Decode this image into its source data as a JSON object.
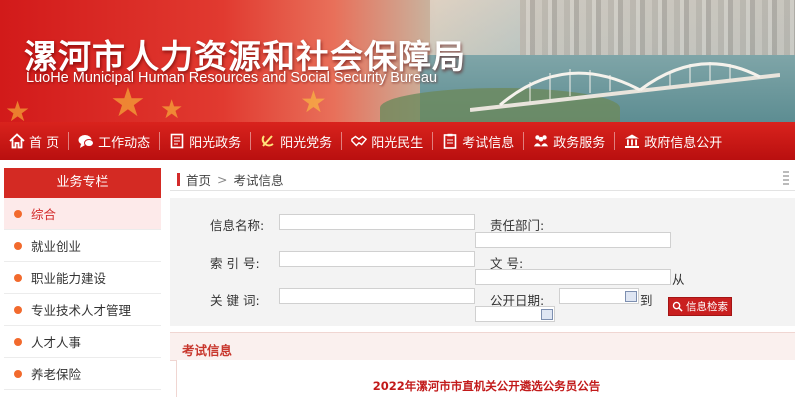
{
  "site": {
    "title": "漯河市人力资源和社会保障局",
    "subtitle": "LuoHe Municipal Human Resources and Social Security Bureau"
  },
  "nav": {
    "items": [
      {
        "label": "首 页",
        "icon": "home-icon"
      },
      {
        "label": "工作动态",
        "icon": "chat-icon"
      },
      {
        "label": "阳光政务",
        "icon": "document-icon"
      },
      {
        "label": "阳光党务",
        "icon": "party-icon"
      },
      {
        "label": "阳光民生",
        "icon": "handshake-icon"
      },
      {
        "label": "考试信息",
        "icon": "clipboard-icon"
      },
      {
        "label": "政务服务",
        "icon": "people-icon"
      },
      {
        "label": "政府信息公开",
        "icon": "government-icon"
      }
    ]
  },
  "sidebar": {
    "title": "业务专栏",
    "items": [
      {
        "label": "综合",
        "active": true
      },
      {
        "label": "就业创业",
        "active": false
      },
      {
        "label": "职业能力建设",
        "active": false
      },
      {
        "label": "专业技术人才管理",
        "active": false
      },
      {
        "label": "人才人事",
        "active": false
      },
      {
        "label": "养老保险",
        "active": false
      }
    ]
  },
  "breadcrumb": {
    "home": "首页",
    "separator": ">",
    "current": "考试信息"
  },
  "search": {
    "name_label": "信息名称:",
    "dept_label": "责任部门:",
    "index_label": "索 引 号:",
    "docno_label": "文    号:",
    "from_label": "从",
    "keyword_label": "关 键 词:",
    "date_label": "公开日期:",
    "to_label": "到",
    "button_label": "信息检索"
  },
  "results": {
    "title": "考试信息",
    "articles": [
      "2022年漯河市市直机关公开遴选公务员公告"
    ]
  },
  "colors": {
    "primary_red": "#d42a23",
    "nav_red": "#c8141a",
    "bullet_orange": "#f26a2d"
  }
}
